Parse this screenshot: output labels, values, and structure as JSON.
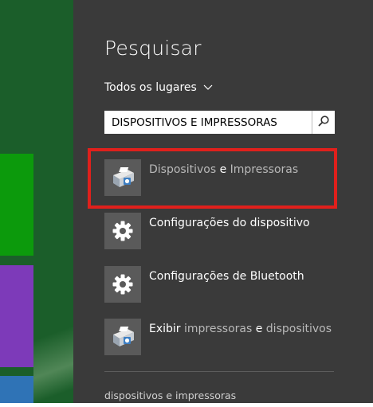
{
  "panel": {
    "title": "Pesquisar",
    "scope": "Todos os lugares",
    "search": {
      "value": "DISPOSITIVOS E IMPRESSORAS",
      "button_icon": "search-icon"
    },
    "results": [
      {
        "icon": "printer-icon",
        "parts": [
          "Dispositivos ",
          "e",
          " Impressoras"
        ]
      },
      {
        "icon": "gear-icon",
        "label": "Configurações do dispositivo"
      },
      {
        "icon": "gear-icon",
        "label": "Configurações de Bluetooth"
      },
      {
        "icon": "printer-icon",
        "parts": [
          "Exibir ",
          "impressoras",
          " e ",
          "dispositivos"
        ]
      }
    ],
    "suggestion": "dispositivos e impressoras"
  },
  "colors": {
    "panel_bg": "#3a3a3a",
    "highlight": "#e0201c",
    "tile_green": "#0c9a0c",
    "tile_purple": "#7d3ab9",
    "tile_blue": "#2f73b6"
  }
}
